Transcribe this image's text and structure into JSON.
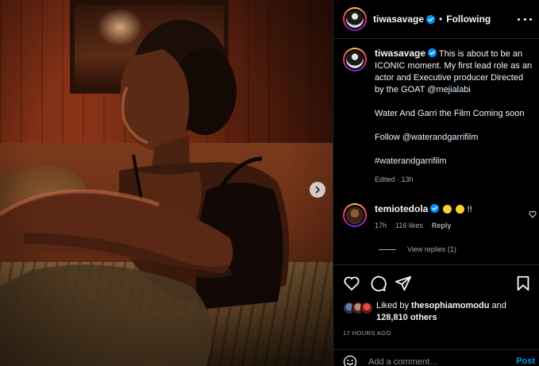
{
  "post_image": {
    "description_icon": "photo",
    "next_button_icon": "chevron-right-icon"
  },
  "header": {
    "username": "tiwasavage",
    "separator": "•",
    "follow_status": "Following",
    "more_icon": "more-horizontal-icon"
  },
  "caption": {
    "username": "tiwasavage",
    "line1": "This is about to be an ICONIC moment. My first lead role as an actor and Executive producer Directed by the GOAT ",
    "mention1": "@mejialabi",
    "line2": "Water And Garri the Film Coming soon",
    "follow_prefix": "Follow ",
    "mention2": "@waterandgarrifilm",
    "hashtag": "#waterandgarrifilm",
    "edited_label": "Edited",
    "time": "13h"
  },
  "comment": {
    "username": "temiotedola",
    "text_suffix": " !!",
    "time": "17h",
    "likes": "116 likes",
    "reply_label": "Reply",
    "view_replies": "View replies (1)"
  },
  "actions": {
    "like_icon": "heart-icon",
    "comment_icon": "comment-icon",
    "share_icon": "send-icon",
    "save_icon": "bookmark-icon"
  },
  "likes": {
    "prefix": "Liked by ",
    "user": "thesophiamomodu",
    "middle": " and",
    "count": "128,810 others"
  },
  "timestamp": "17 HOURS AGO",
  "add_comment": {
    "placeholder": "Add a comment…",
    "post_label": "Post"
  },
  "colors": {
    "background": "#000000",
    "text": "#f5f5f5",
    "muted": "#a8a8a8",
    "link": "#e0f1ff",
    "accent": "#0095f6",
    "verified": "#0095f6",
    "divider": "#262626"
  }
}
